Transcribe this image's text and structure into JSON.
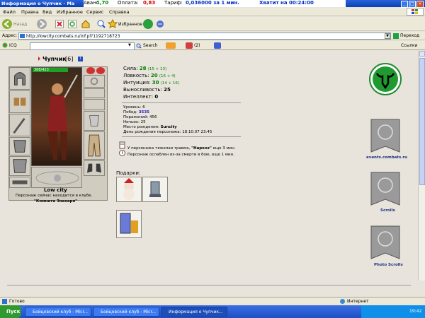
{
  "window": {
    "title": "Информация о Чупчик - Ma",
    "ticker": {
      "avans_label": "Аванс",
      "avans_value": "1,70",
      "oplata_label": "Оплата:",
      "oplata_value": "0,83",
      "tarif_label": "Тариф:",
      "tarif_value": "0,036000 за 1 мин.",
      "remaining": "Хватит на 00:24:00"
    }
  },
  "menu": [
    "Файл",
    "Правка",
    "Вид",
    "Избранное",
    "Сервис",
    "Справка"
  ],
  "toolbar": {
    "back_label": "Назад",
    "favorites_label": "Избранное"
  },
  "address": {
    "label": "Адрес:",
    "url": "http://lowcity.combats.ru/inf.pl?1192718723",
    "go_label": "Переход"
  },
  "icqbar": {
    "icq_label": "ICQ",
    "search_label": "Search",
    "counter": "(2)",
    "links_label": "Ссылки"
  },
  "character": {
    "name": "Чупчик",
    "level": "[6]",
    "hp": "388/423",
    "city": "Low city",
    "location_text": "Персонаж сейчас находится в клубе.",
    "location_room": "\"Комната Знахаря\""
  },
  "stats": [
    {
      "label": "Сила:",
      "value": "28",
      "detail": "(15 + 13)"
    },
    {
      "label": "Ловкость:",
      "value": "20",
      "detail": "(16 + 4)"
    },
    {
      "label": "Интуиция:",
      "value": "30",
      "detail": "(14 + 16)"
    },
    {
      "label": "Выносливость:",
      "value": "25",
      "detail": ""
    },
    {
      "label": "Интеллект:",
      "value": "0",
      "detail": ""
    }
  ],
  "info": {
    "level_label": "Уровень:",
    "level_value": "6",
    "wins_label": "Побед:",
    "wins_value": "3535",
    "losses_label": "Поражений:",
    "losses_value": "456",
    "draws_label": "Ничьих:",
    "draws_value": "25",
    "birthplace_label": "Место рождения:",
    "birthplace_value": "Suncity",
    "birthday_label": "День рождения персонажа:",
    "birthday_value": "18.10.07 23:45"
  },
  "effects": {
    "trauma_prefix": "У персонажа тяжелая травма,",
    "trauma_name": "\"Наркоз\"",
    "trauma_suffix": "еще 3 мин.",
    "weak_text": "Персонаж ослаблен из-за смерти в бою, еще 1 мин."
  },
  "gifts_label": "Подарки:",
  "sidebar": {
    "events": "events.combats.ru",
    "scrolls": "Scrolls",
    "photo": "Photo Scrolls"
  },
  "status": {
    "ready": "Готово",
    "zone": "Интернет"
  },
  "taskbar": {
    "start": "Пуск",
    "tasks": [
      "Бойцовский клуб - Micr...",
      "Бойцовский клуб - Micr...",
      "Информация о Чупчик..."
    ],
    "clock": "19:42"
  },
  "colors": {
    "stat_value": "#008000",
    "wins_value": "#2020c0",
    "link": "#1a2f80"
  }
}
